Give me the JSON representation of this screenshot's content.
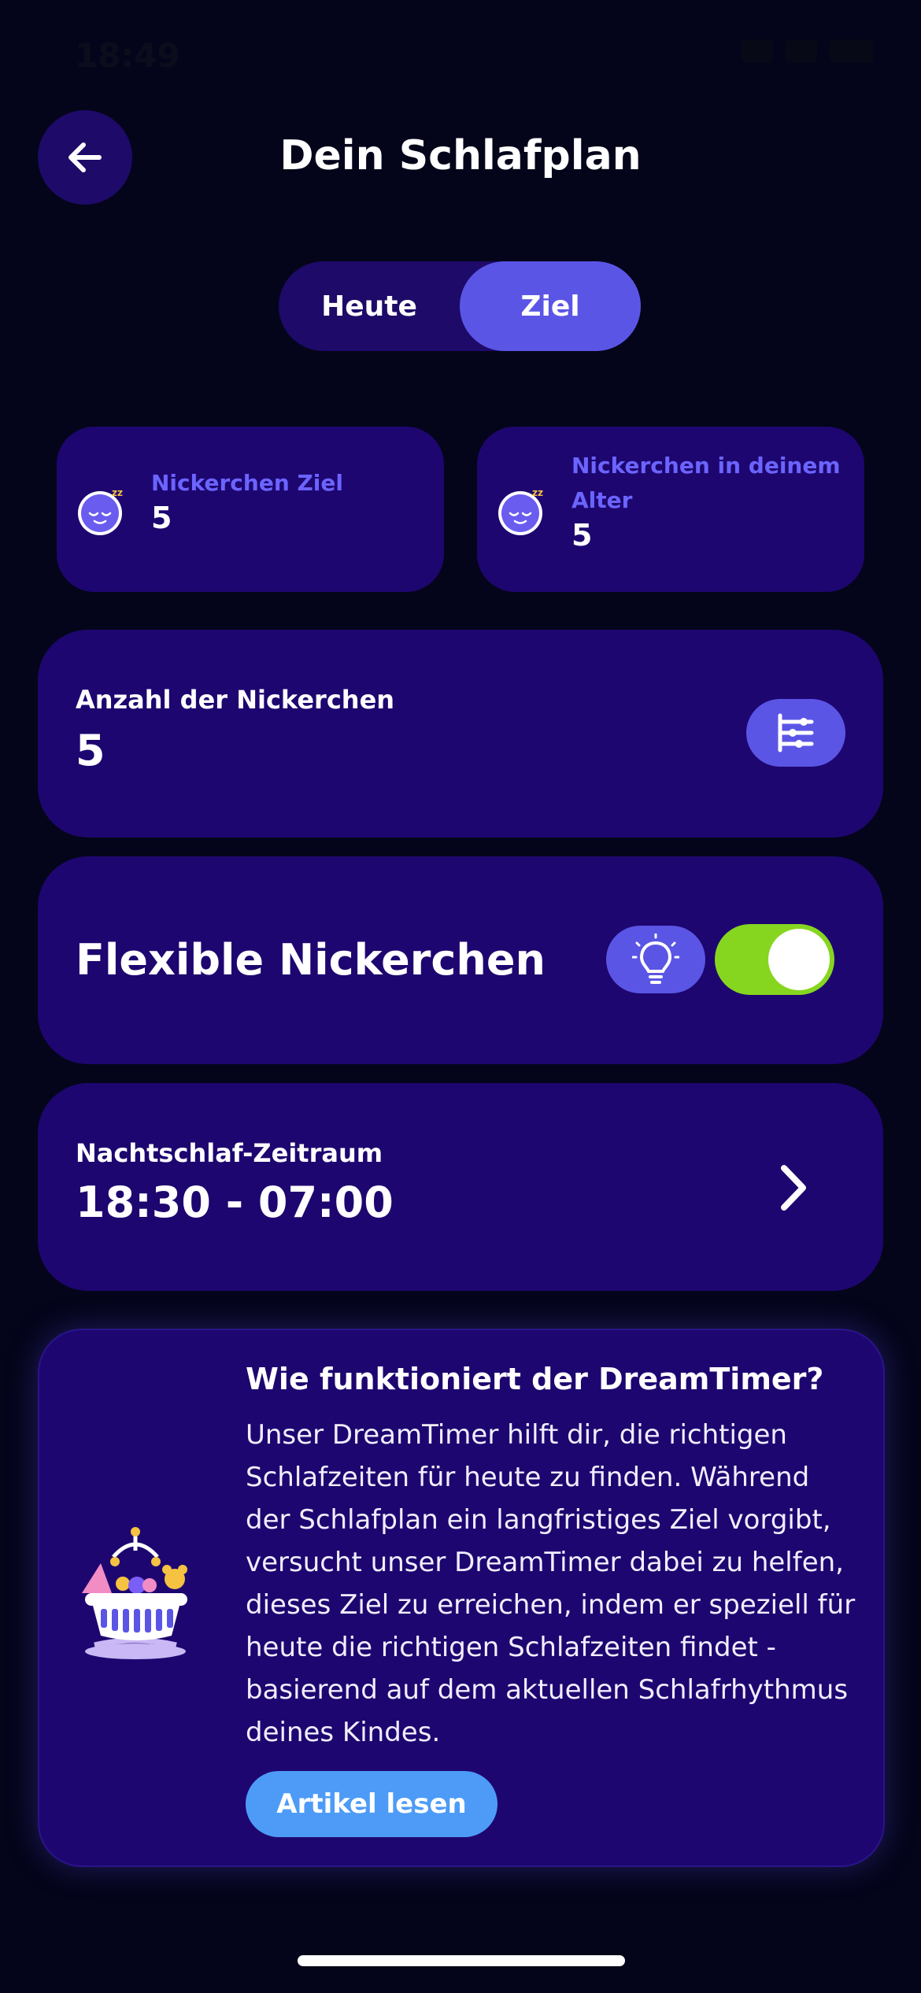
{
  "status_bar": {
    "time": "18:49"
  },
  "header": {
    "title": "Dein Schlafplan",
    "back_icon": "arrow-left-icon"
  },
  "segmented": {
    "options": [
      "Heute",
      "Ziel"
    ],
    "selected": "Ziel"
  },
  "stats": [
    {
      "label": "Nickerchen Ziel",
      "value": "5",
      "icon": "sleepy-face-icon"
    },
    {
      "label": "Nickerchen in deinem Alter",
      "value": "5",
      "icon": "sleepy-face-icon"
    }
  ],
  "nap_count": {
    "label": "Anzahl der Nickerchen",
    "value": "5",
    "icon": "sliders-icon"
  },
  "flexible": {
    "label": "Flexible Nickerchen",
    "toggle_on": true,
    "icon": "lightbulb-icon"
  },
  "night_sleep": {
    "label": "Nachtschlaf-Zeitraum",
    "value": "18:30 - 07:00",
    "icon": "chevron-right-icon"
  },
  "info": {
    "title": "Wie funktioniert der DreamTimer?",
    "body": "Unser DreamTimer hilft dir, die richtigen Schlafzeiten für heute zu finden. Während der Schlafplan ein langfristiges Ziel vorgibt, versucht unser DreamTimer dabei zu helfen, dieses Ziel zu erreichen, indem er speziell für heute die richtigen Schlafzeiten findet - basierend auf dem aktuellen Schlafrhythmus deines Kindes.",
    "button": "Artikel lesen",
    "illustration": "crib-illustration"
  },
  "colors": {
    "background": "#04051a",
    "card": "#1e0670",
    "accent": "#5b55e6",
    "toggle": "#86d61f",
    "button": "#4d9bf7"
  }
}
